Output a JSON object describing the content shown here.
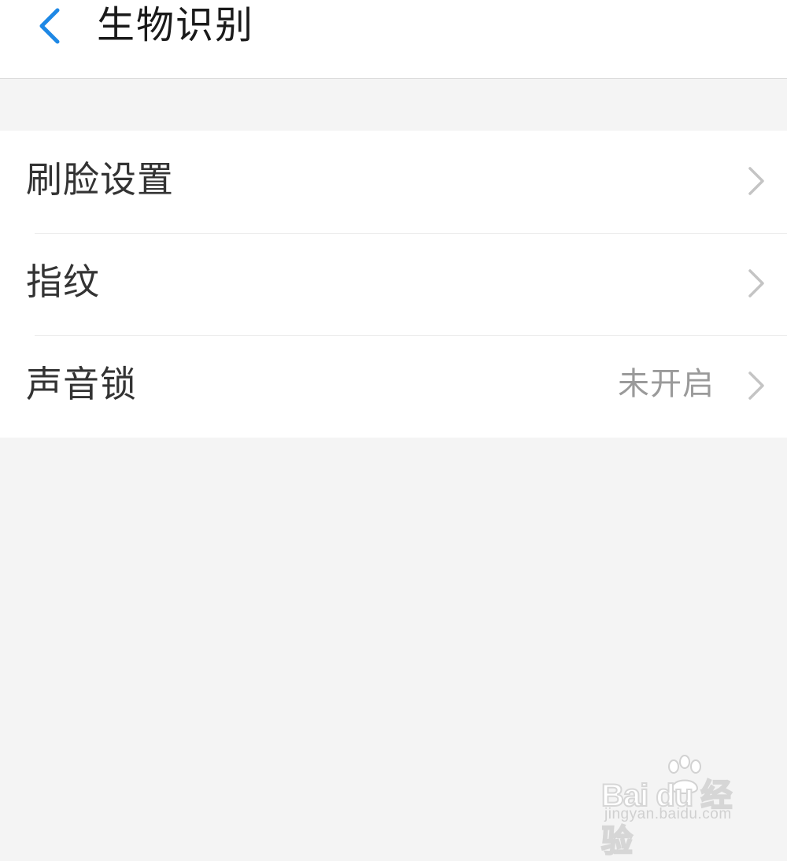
{
  "header": {
    "back_icon": "chevron-left-icon",
    "title": "生物识别",
    "accent_color": "#1e88e5"
  },
  "settings": {
    "items": [
      {
        "label": "刷脸设置",
        "value": "",
        "icon": "chevron-right-icon"
      },
      {
        "label": "指纹",
        "value": "",
        "icon": "chevron-right-icon"
      },
      {
        "label": "声音锁",
        "value": "未开启",
        "icon": "chevron-right-icon"
      }
    ]
  },
  "watermark": {
    "logo_text": "Bai du 经验",
    "url": "jingyan.baidu.com"
  }
}
